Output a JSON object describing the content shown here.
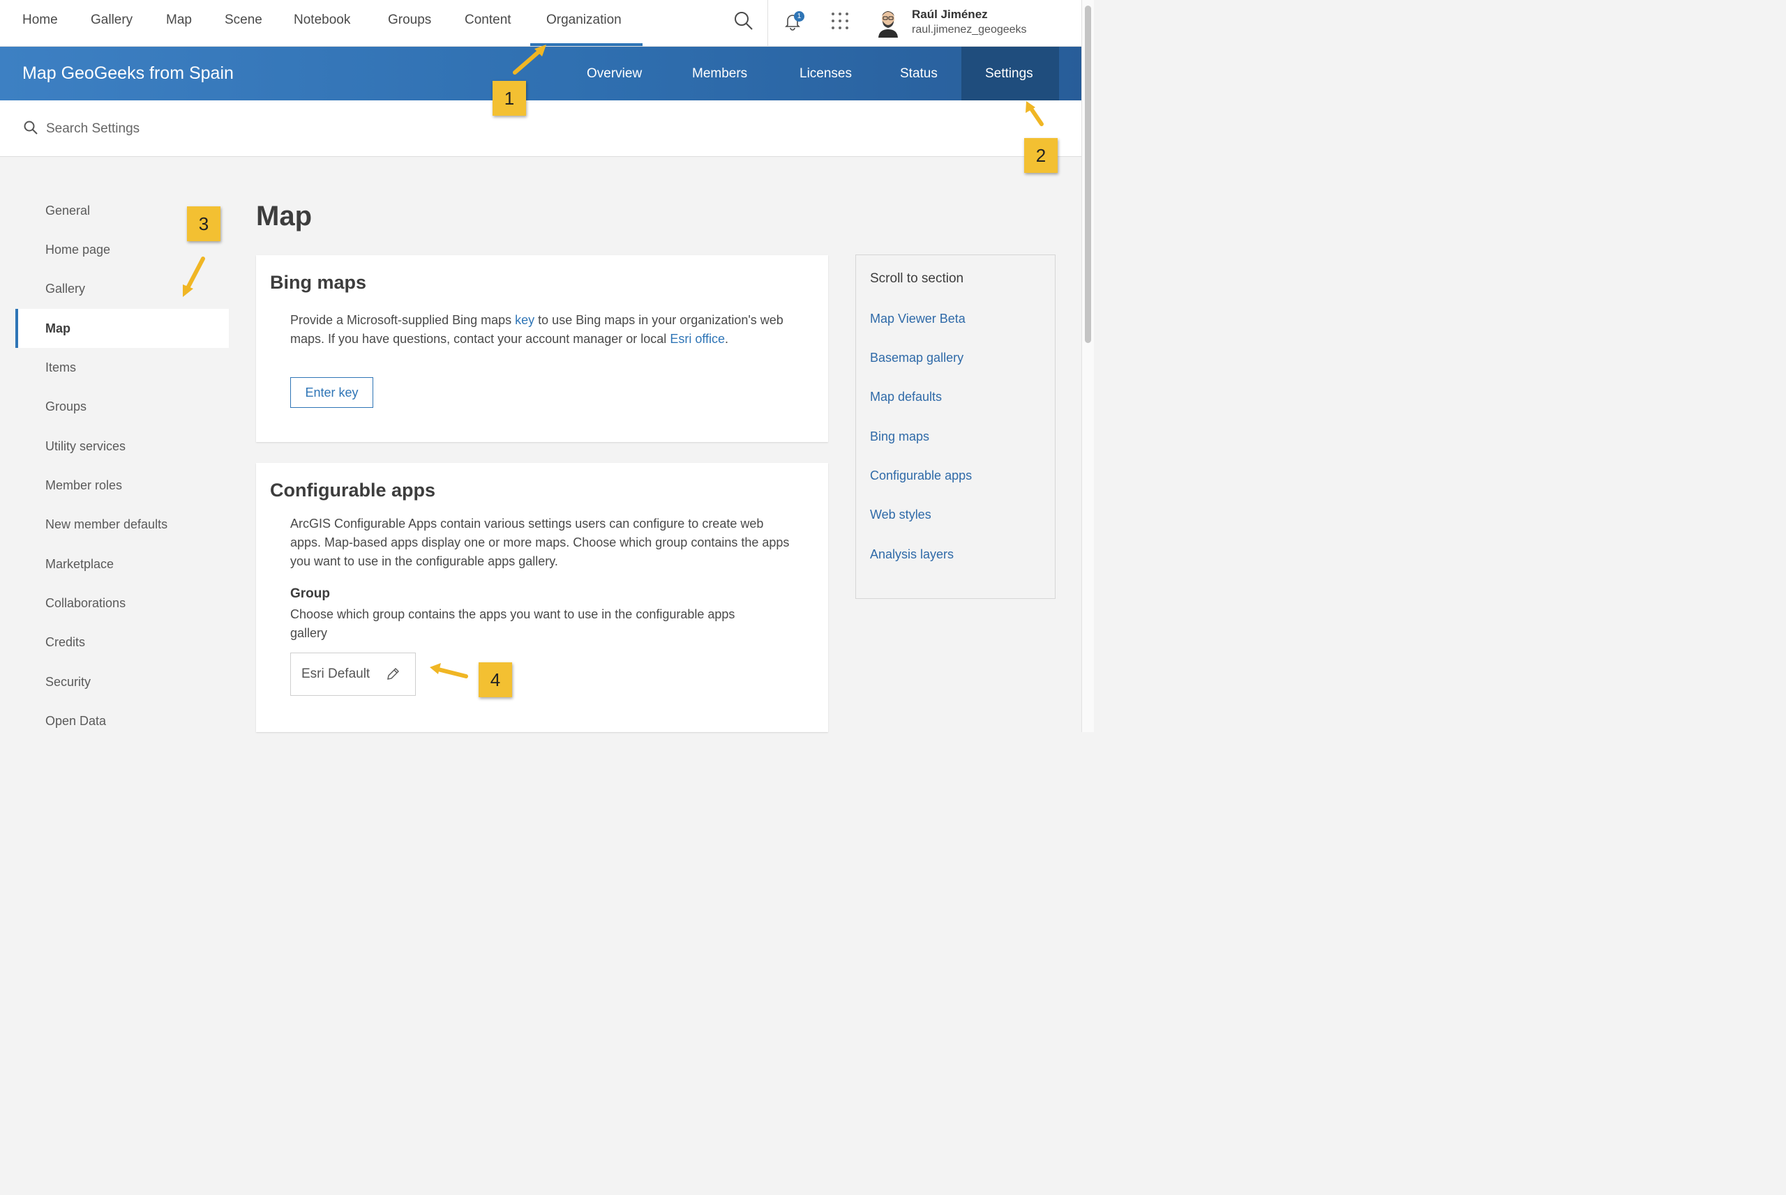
{
  "topnav": {
    "items": [
      "Home",
      "Gallery",
      "Map",
      "Scene",
      "Notebook",
      "Groups",
      "Content",
      "Organization"
    ],
    "active": "Organization",
    "notification_count": "1",
    "user": {
      "name": "Raúl Jiménez",
      "handle": "raul.jimenez_geogeeks"
    }
  },
  "org": {
    "title": "Map GeoGeeks from Spain",
    "tabs": [
      "Overview",
      "Members",
      "Licenses",
      "Status",
      "Settings"
    ],
    "active_tab": "Settings"
  },
  "search": {
    "placeholder": "Search Settings"
  },
  "sidebar": {
    "items": [
      "General",
      "Home page",
      "Gallery",
      "Map",
      "Items",
      "Groups",
      "Utility services",
      "Member roles",
      "New member defaults",
      "Marketplace",
      "Collaborations",
      "Credits",
      "Security",
      "Open Data"
    ],
    "active": "Map"
  },
  "page": {
    "title": "Map"
  },
  "bing": {
    "title": "Bing maps",
    "text_part1": "Provide a Microsoft-supplied Bing maps ",
    "link_key": "key",
    "text_part2": " to use Bing maps in your organization's web maps. If you have questions, contact your account manager or local ",
    "link_office": "Esri office",
    "text_part3": ".",
    "button": "Enter key"
  },
  "configurable": {
    "title": "Configurable apps",
    "text": "ArcGIS Configurable Apps contain various settings users can configure to create web apps. Map-based apps display one or more maps. Choose which group contains the apps you want to use in the configurable apps gallery.",
    "group_label": "Group",
    "group_description": "Choose which group contains the apps you want to use in the configurable apps gallery",
    "group_value": "Esri Default"
  },
  "scroll_section": {
    "title": "Scroll to section",
    "links": [
      "Map Viewer Beta",
      "Basemap gallery",
      "Map defaults",
      "Bing maps",
      "Configurable apps",
      "Web styles",
      "Analysis layers"
    ]
  },
  "annotations": [
    "1",
    "2",
    "3",
    "4"
  ],
  "colors": {
    "accent": "#2f75b6",
    "header_blue": "#2f6fb0",
    "badge": "#f3c032"
  }
}
